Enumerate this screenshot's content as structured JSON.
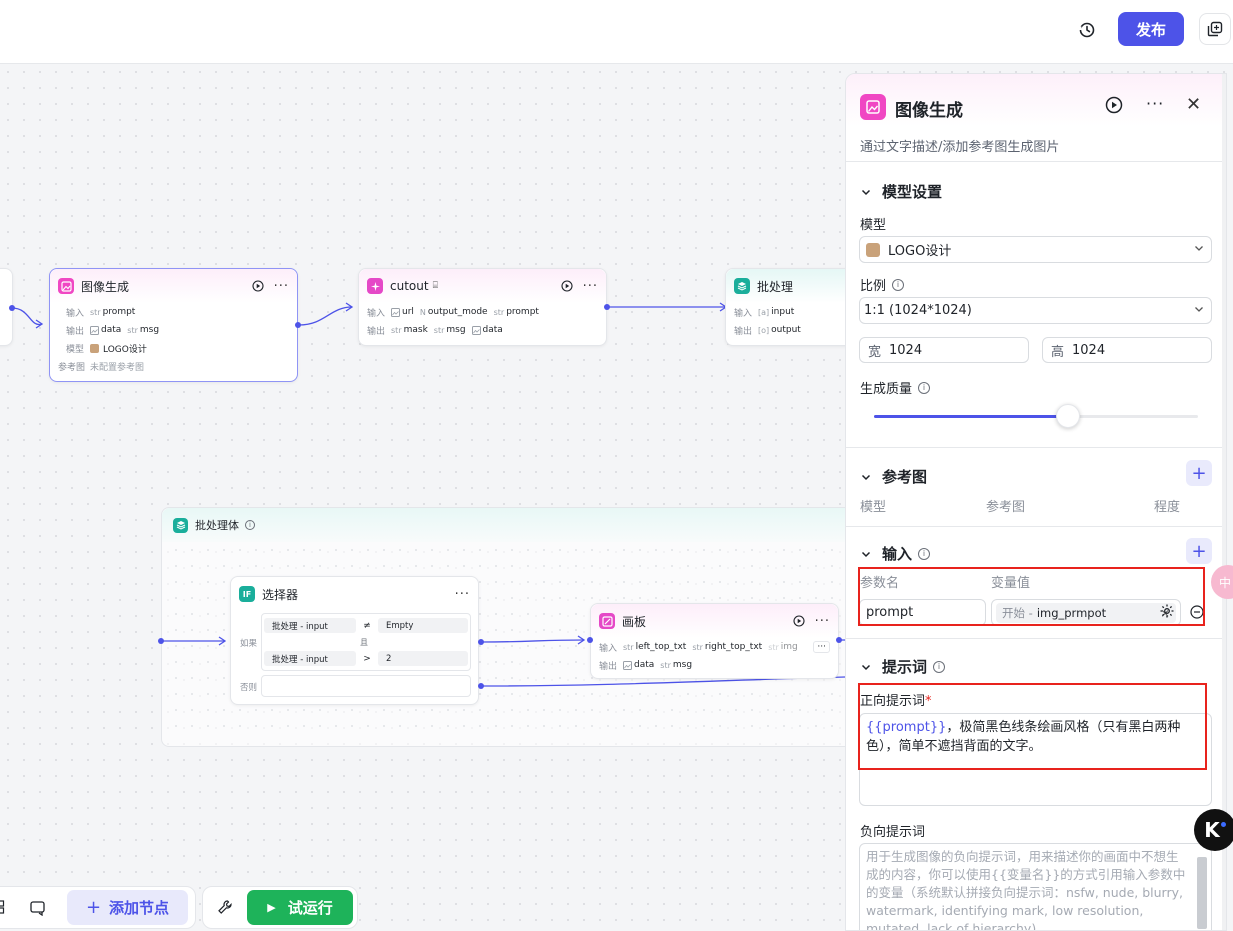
{
  "topbar": {
    "publish_label": "发布"
  },
  "nodes": {
    "image_gen": {
      "title": "图像生成",
      "input_label": "输入",
      "input_type": "str",
      "input_name": "prompt",
      "output_label": "输出",
      "output_1_name": "data",
      "output_2_type": "str",
      "output_2_name": "msg",
      "model_label": "模型",
      "model_value": "LOGO设计",
      "ref_label": "参考图",
      "ref_value": "未配置参考图"
    },
    "cutout": {
      "title": "cutout",
      "input_label": "输入",
      "input_1_name": "url",
      "input_2_name": "output_mode",
      "input_3_type": "str",
      "input_3_name": "prompt",
      "output_label": "输出",
      "output_1_type": "str",
      "output_1_name": "mask",
      "output_2_type": "str",
      "output_2_name": "msg",
      "output_3_name": "data"
    },
    "batch": {
      "title": "批处理",
      "input_label": "输入",
      "input_name": "input",
      "output_label": "输出",
      "output_name": "output"
    },
    "batch_body": {
      "title": "批处理体"
    },
    "selector": {
      "title": "选择器",
      "if_label": "如果",
      "and_label": "且",
      "else_label": "否则",
      "cond1_left": "批处理 - input",
      "cond1_op": "≠",
      "cond1_right": "Empty",
      "cond2_left": "批处理 - input",
      "cond2_op": ">",
      "cond2_right": "2"
    },
    "canvas_node": {
      "title": "画板",
      "input_label": "输入",
      "input_1_type": "str",
      "input_1_name": "left_top_txt",
      "input_2_type": "str",
      "input_2_name": "right_top_txt",
      "input_3_type": "str",
      "input_3_name": "img",
      "output_label": "输出",
      "output_1_name": "data",
      "output_2_type": "str",
      "output_2_name": "msg"
    }
  },
  "panel": {
    "title": "图像生成",
    "description": "通过文字描述/添加参考图生成图片",
    "model_section": "模型设置",
    "model_label": "模型",
    "model_value": "LOGO设计",
    "ratio_label": "比例",
    "ratio_value": "1:1 (1024*1024)",
    "width_prefix": "宽",
    "width_value": "1024",
    "height_prefix": "高",
    "height_value": "1024",
    "quality_label": "生成质量",
    "quality_level": 0.6,
    "ref_section": "参考图",
    "ref_col_model": "模型",
    "ref_col_image": "参考图",
    "ref_col_degree": "程度",
    "input_section": "输入",
    "param_name_col": "参数名",
    "var_value_col": "变量值",
    "param_name_value": "prompt",
    "var_source": "开始 -",
    "var_name": "img_prmpot",
    "prompt_section": "提示词",
    "positive_label": "正向提示词",
    "positive_var": "{{prompt}}",
    "positive_text": "，极简黑色线条绘画风格（只有黑白两种色），简单不遮挡背面的文字。",
    "negative_label": "负向提示词",
    "negative_placeholder": "用于生成图像的负向提示词，用来描述你的画面中不想生成的内容，你可以使用{{变量名}}的方式引用输入参数中的变量（系统默认拼接负向提示词：nsfw, nude, blurry, watermark, identifying mark, low resolution, mutated, lack of hierarchy)"
  },
  "toolbar": {
    "add_node_label": "添加节点",
    "run_label": "试运行"
  },
  "floating": {
    "side_tab_label": "中",
    "logo_letter": "K"
  },
  "colors": {
    "accent": "#4d53e8",
    "run_green": "#1eb35a",
    "image_node_pink": "#f047c3",
    "batch_teal": "#1aae9b",
    "highlight_red": "#e8231d"
  }
}
